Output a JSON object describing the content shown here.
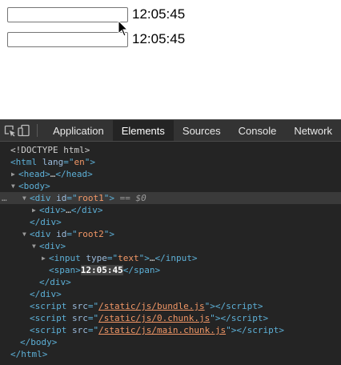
{
  "page": {
    "row1": {
      "input_value": "",
      "time": "12:05:45"
    },
    "row2": {
      "input_value": "",
      "time": "12:05:45"
    }
  },
  "devtools": {
    "toolbar": {
      "icons": [
        "inspect-icon",
        "device-toggle-icon"
      ],
      "tabs": [
        {
          "label": "Application",
          "active": false
        },
        {
          "label": "Elements",
          "active": true
        },
        {
          "label": "Sources",
          "active": false
        },
        {
          "label": "Console",
          "active": false
        },
        {
          "label": "Network",
          "active": false
        }
      ]
    },
    "tree": {
      "doctype": "<!DOCTYPE html>",
      "html_open_tag": "html",
      "html_attr": "lang",
      "html_attr_val": "en",
      "head": "head",
      "head_ellipsis": "…",
      "body": "body",
      "div": "div",
      "id_attr": "id",
      "root1": "root1",
      "eq_sign": "==",
      "dollar0": "$0",
      "root2": "root2",
      "input": "input",
      "type_attr": "type",
      "type_val": "text",
      "span": "span",
      "span_text": "12:05:45",
      "script": "script",
      "src_attr": "src",
      "scripts": [
        "/static/js/bundle.js",
        "/static/js/0.chunk.js",
        "/static/js/main.chunk.js"
      ],
      "dots": "…"
    },
    "colors": {
      "tag": "#5db0d7",
      "attr_name": "#9bbbdc",
      "attr_value": "#f29766",
      "panel_bg": "#242424",
      "toolbar_bg": "#333333"
    }
  }
}
